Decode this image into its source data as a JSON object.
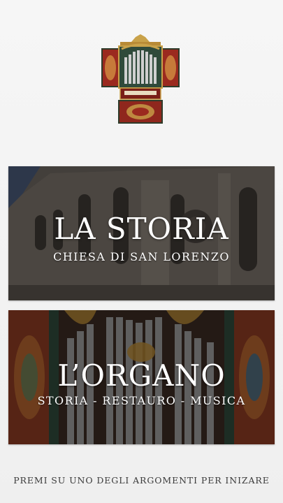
{
  "header": {
    "logo_icon": "organ-logo-icon"
  },
  "cards": {
    "storia": {
      "title": "LA STORIA",
      "subtitle": "CHIESA DI SAN LORENZO",
      "background_icon": "church-facade-photo"
    },
    "organo": {
      "title": "L’ORGANO",
      "subtitle": "STORIA - RESTAURO - MUSICA",
      "background_icon": "organ-pipes-photo"
    }
  },
  "footer": {
    "hint": "PREMI SU UNO DEGLI ARGOMENTI PER INIZARE"
  },
  "colors": {
    "background": "#f2f2f2",
    "card_text": "#ffffff",
    "hint_text": "#3a3a3a",
    "organ_red": "#9b2a1f",
    "organ_gold": "#c9a24a"
  }
}
